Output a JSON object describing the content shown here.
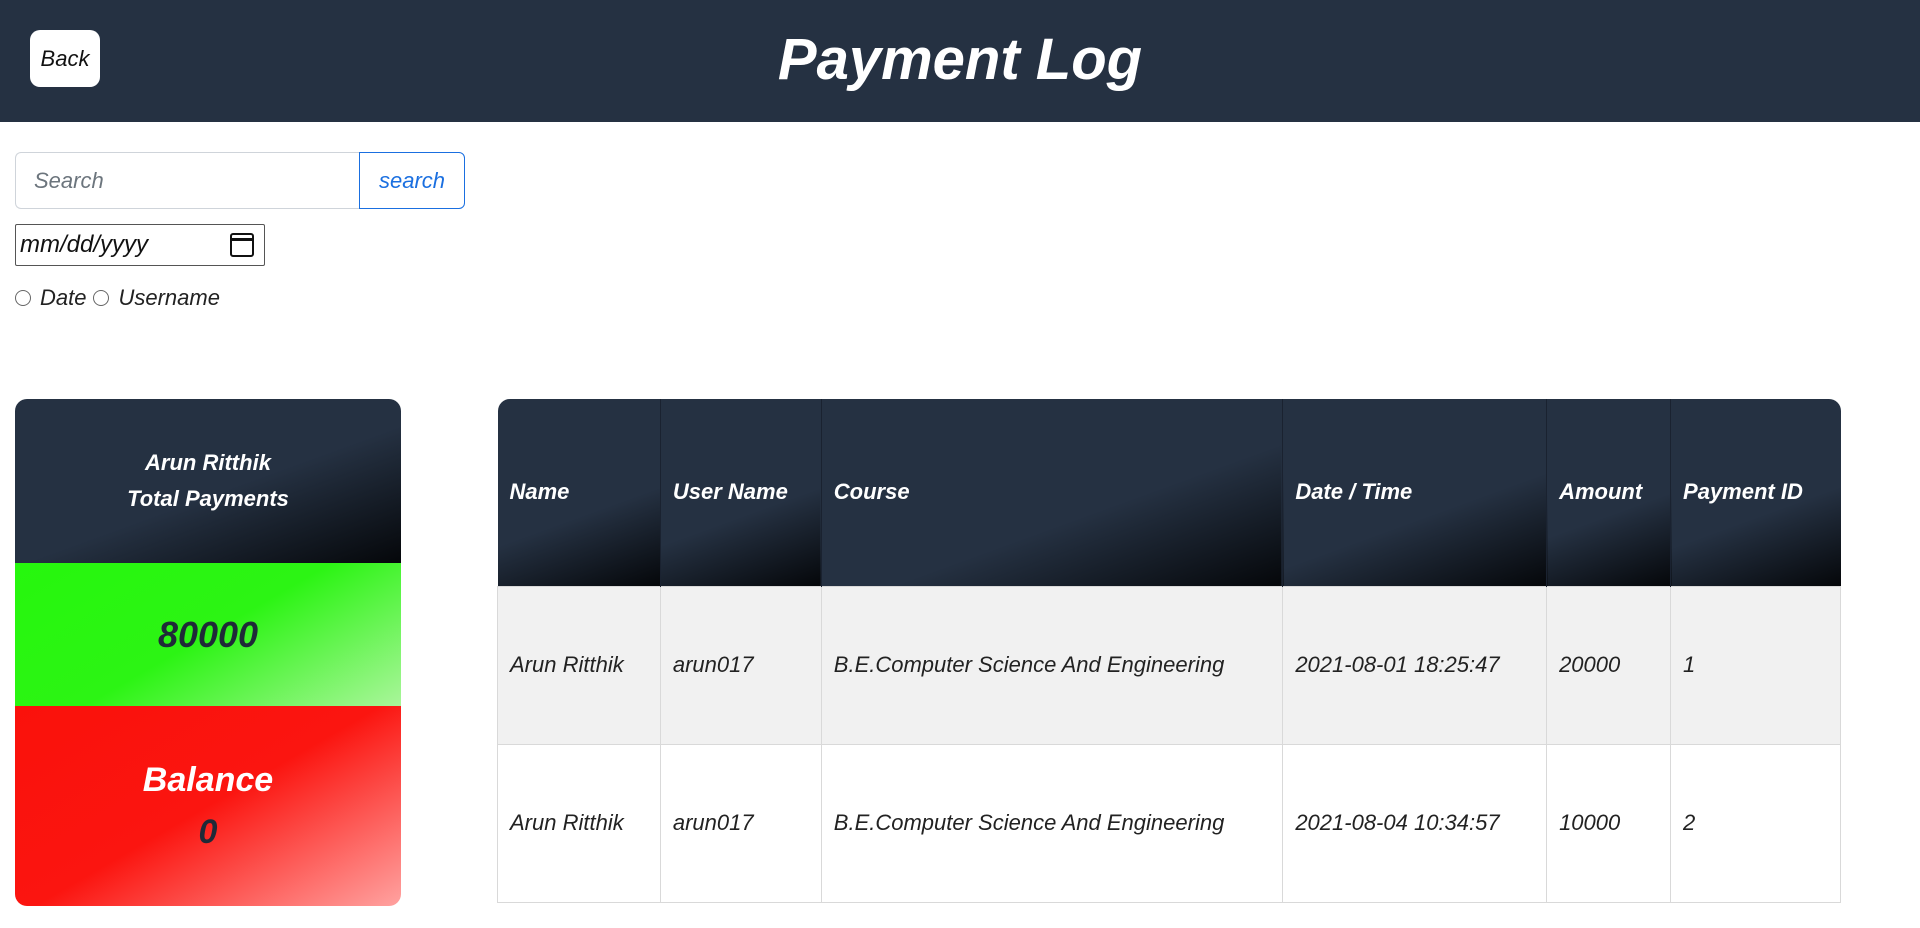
{
  "header": {
    "back_label": "Back",
    "title": "Payment Log"
  },
  "search": {
    "placeholder": "Search",
    "value": "",
    "button_label": "search"
  },
  "date_filter": {
    "placeholder": "mm/dd/yyyy",
    "icon": "calendar-icon"
  },
  "filter_options": [
    {
      "label": "Date",
      "checked": false
    },
    {
      "label": "Username",
      "checked": false
    }
  ],
  "summary": {
    "name": "Arun Ritthik",
    "subtitle": "Total Payments",
    "total_paid": "80000",
    "balance_label": "Balance",
    "balance_value": "0",
    "colors": {
      "header": "#253142",
      "paid": "#26f70d",
      "balance": "#fa110b"
    }
  },
  "table": {
    "columns": [
      "Name",
      "User Name",
      "Course",
      "Date / Time",
      "Amount",
      "Payment ID"
    ],
    "rows": [
      [
        "Arun Ritthik",
        "arun017",
        "B.E.Computer Science And Engineering",
        "2021-08-01 18:25:47",
        "20000",
        "1"
      ],
      [
        "Arun Ritthik",
        "arun017",
        "B.E.Computer Science And Engineering",
        "2021-08-04 10:34:57",
        "10000",
        "2"
      ]
    ]
  }
}
